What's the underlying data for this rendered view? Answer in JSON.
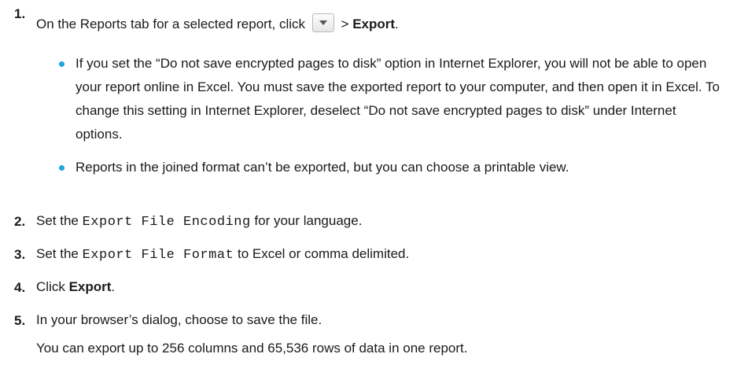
{
  "steps": [
    {
      "number": "1.",
      "pre": "On the Reports tab for a selected report, click",
      "sep": ">",
      "bold": "Export",
      "post": ".",
      "dropdown_icon": "chevron-down-icon",
      "bullets": [
        "If you set the “Do not save encrypted pages to disk” option in Internet Explorer, you will not be able to open your report online in Excel. You must save the exported report to your computer, and then open it in Excel. To change this setting in Internet Explorer, deselect “Do not save encrypted pages to disk” under Internet options.",
        "Reports in the joined format can’t be exported, but you can choose a printable view."
      ]
    },
    {
      "number": "2.",
      "pre": "Set the",
      "code": "Export File Encoding",
      "post": "for your language."
    },
    {
      "number": "3.",
      "pre": "Set the",
      "code": "Export File Format",
      "post": "to Excel or comma delimited."
    },
    {
      "number": "4.",
      "pre": "Click",
      "bold": "Export",
      "post": "."
    },
    {
      "number": "5.",
      "text": "In your browser’s dialog, choose to save the file."
    }
  ],
  "note": "You can export up to 256 columns and 65,536 rows of data in one report.",
  "colors": {
    "bullet": "#1fa6e0",
    "text": "#1a1a1a"
  }
}
